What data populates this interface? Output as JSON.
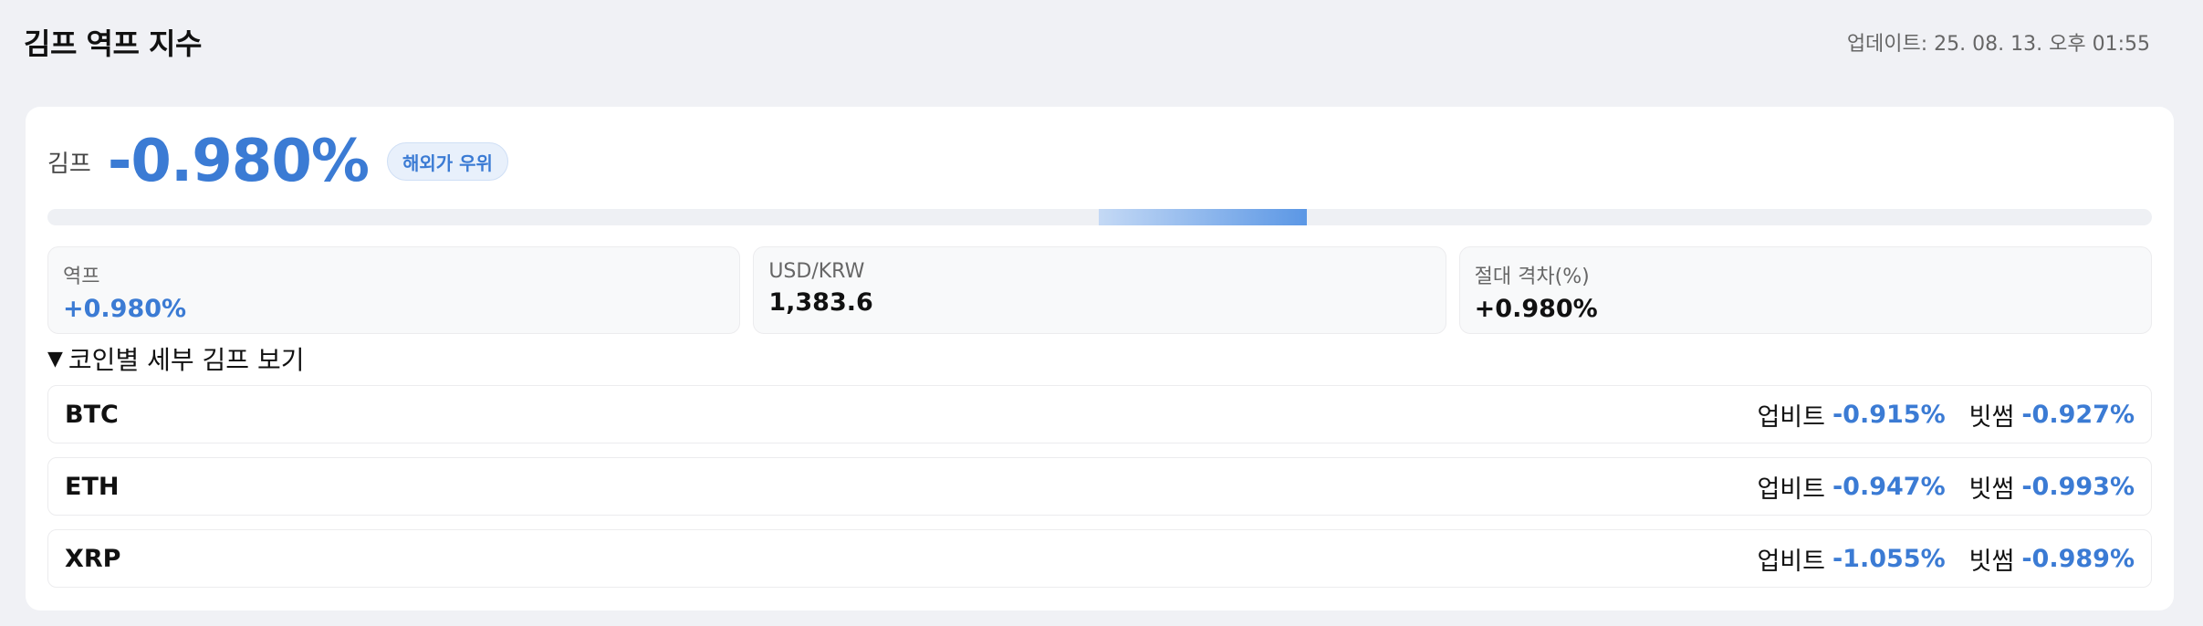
{
  "header": {
    "title": "김프 역프 지수",
    "updated": "업데이트: 25. 08. 13. 오후 01:55"
  },
  "kimp": {
    "label": "김프",
    "value": "-0.980%",
    "badge": "해외가 우위",
    "bar_fraction": 0.51
  },
  "stats": [
    {
      "label": "역프",
      "value": "+0.980%"
    },
    {
      "label": "USD/KRW",
      "value": "1,383.6"
    },
    {
      "label": "절대 격차(%)",
      "value": "+0.980%"
    }
  ],
  "details": {
    "toggle_symbol": "▼",
    "toggle_label": "코인별 세부 김프 보기"
  },
  "coins": [
    {
      "name": "BTC",
      "ex1_label": "업비트",
      "ex1_value": "-0.915%",
      "ex2_label": "빗썸",
      "ex2_value": "-0.927%"
    },
    {
      "name": "ETH",
      "ex1_label": "업비트",
      "ex1_value": "-0.947%",
      "ex2_label": "빗썸",
      "ex2_value": "-0.993%"
    },
    {
      "name": "XRP",
      "ex1_label": "업비트",
      "ex1_value": "-1.055%",
      "ex2_label": "빗썸",
      "ex2_value": "-0.989%"
    }
  ],
  "colors": {
    "accent": "#3b7bd4",
    "background": "#f0f1f5"
  }
}
